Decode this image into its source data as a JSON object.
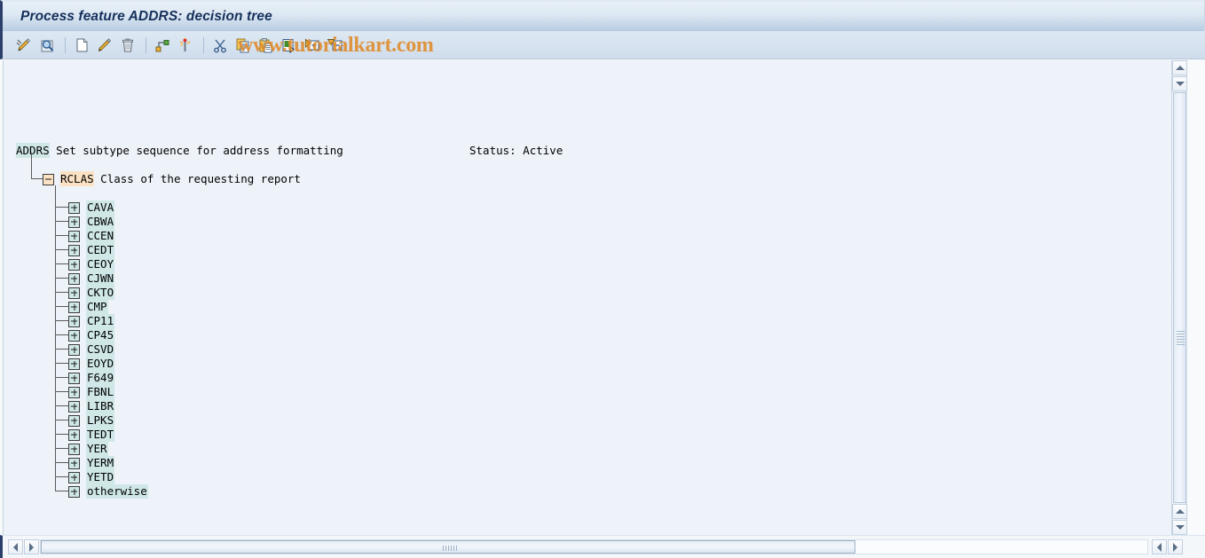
{
  "window": {
    "title": "Process feature ADDRS: decision tree"
  },
  "watermark": {
    "text": "www.tutorialkart.com",
    "color": "#e08a28"
  },
  "toolbar": {
    "buttons": [
      {
        "name": "change-mode-icon",
        "tooltip": "Change"
      },
      {
        "name": "display-mode-icon",
        "tooltip": "Display"
      },
      {
        "name": "create-icon",
        "tooltip": "Create"
      },
      {
        "name": "edit-node-icon",
        "tooltip": "Change node"
      },
      {
        "name": "delete-icon",
        "tooltip": "Delete"
      },
      {
        "name": "structure-icon",
        "tooltip": "Structure"
      },
      {
        "name": "magic-wand-icon",
        "tooltip": "Attributes"
      },
      {
        "name": "cut-icon",
        "tooltip": "Cut"
      },
      {
        "name": "copy-icon",
        "tooltip": "Copy"
      },
      {
        "name": "paste-icon",
        "tooltip": "Paste"
      },
      {
        "name": "insert-node-icon",
        "tooltip": "Insert node"
      },
      {
        "name": "expand-subtree-icon",
        "tooltip": "Expand subtree"
      },
      {
        "name": "collapse-subtree-icon",
        "tooltip": "Collapse subtree"
      }
    ]
  },
  "tree": {
    "root": {
      "code": "ADDRS",
      "description": "Set subtype sequence for address formatting"
    },
    "status": "Status: Active",
    "level1": {
      "code": "RCLAS",
      "description": "Class of the requesting report",
      "icon": "folder-collapse-icon"
    },
    "children": [
      {
        "label": "CAVA"
      },
      {
        "label": "CBWA"
      },
      {
        "label": "CCEN"
      },
      {
        "label": "CEDT"
      },
      {
        "label": "CEOY"
      },
      {
        "label": "CJWN"
      },
      {
        "label": "CKTO"
      },
      {
        "label": "CMP"
      },
      {
        "label": "CP11"
      },
      {
        "label": "CP45"
      },
      {
        "label": "CSVD"
      },
      {
        "label": "EOYD"
      },
      {
        "label": "F649"
      },
      {
        "label": "FBNL"
      },
      {
        "label": "LIBR"
      },
      {
        "label": "LPKS"
      },
      {
        "label": "TEDT"
      },
      {
        "label": "YER"
      },
      {
        "label": "YERM"
      },
      {
        "label": "YETD"
      },
      {
        "label": "otherwise"
      }
    ]
  },
  "scrollbars": {
    "vertical": {
      "up_arrow": "scroll-up-icon",
      "down_arrow": "scroll-down-icon"
    },
    "horizontal": {
      "left_arrow": "scroll-left-icon",
      "right_arrow": "scroll-right-icon"
    }
  },
  "colors": {
    "title_text": "#16305c",
    "highlight_cyan": "#cfe7e7",
    "highlight_orange": "#fbe2c4",
    "content_bg": "#eef3f9",
    "accent_navy": "#2c3f6b"
  }
}
